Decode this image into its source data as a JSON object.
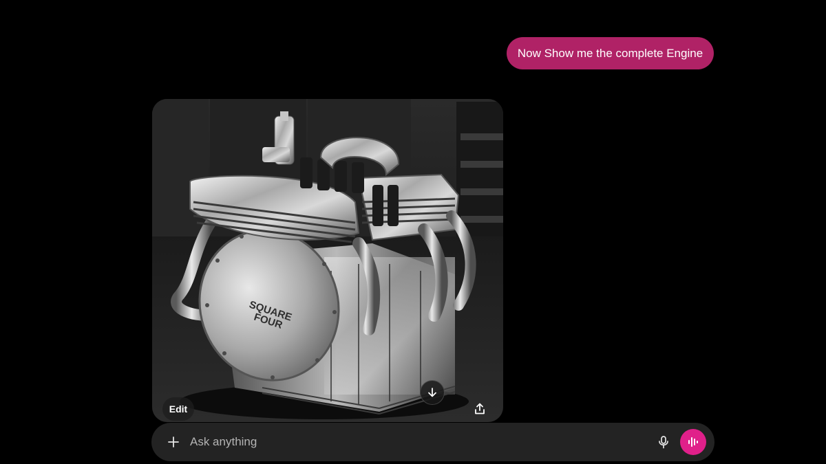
{
  "chat": {
    "user_message": "Now Show me the complete Engine"
  },
  "image_result": {
    "engine_cover_text_line1": "SQUARE",
    "engine_cover_text_line2": "FOUR",
    "edit_label": "Edit",
    "icons": {
      "download": "download-arrow-icon",
      "share": "share-upload-icon"
    }
  },
  "composer": {
    "placeholder": "Ask anything",
    "value": "",
    "icons": {
      "attach": "plus-icon",
      "mic": "microphone-icon",
      "voice": "voice-waveform-icon"
    }
  },
  "colors": {
    "background": "#000000",
    "user_bubble": "#b02266",
    "composer_bg": "#232323",
    "voice_button": "#e0208a"
  }
}
